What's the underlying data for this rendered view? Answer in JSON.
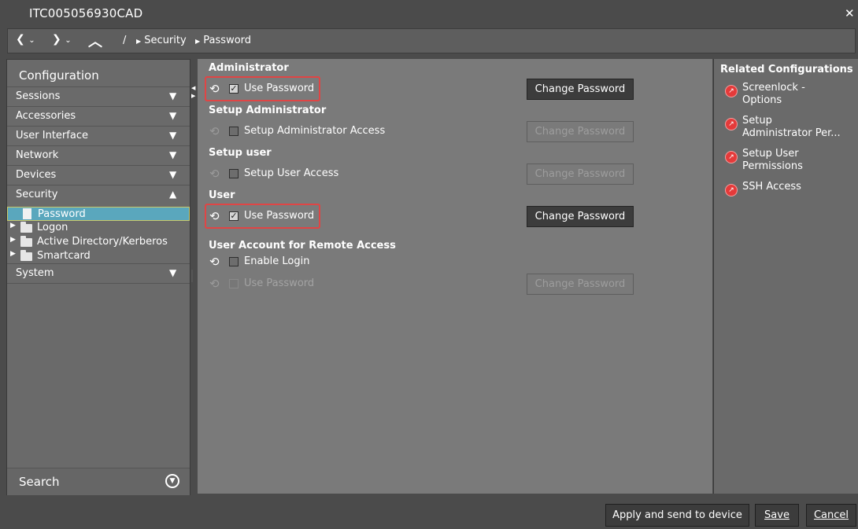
{
  "window": {
    "title": "ITC005056930CAD",
    "close_glyph": "✕"
  },
  "nav": {
    "back_glyph": "❮",
    "forward_glyph": "❯",
    "up_glyph": "︿",
    "dropdown_glyph": "⌄",
    "root_sep": "/",
    "breadcrumbs": [
      "Security",
      "Password"
    ],
    "crumb_glyph": "▶"
  },
  "sidebar": {
    "title": "Configuration",
    "collapsed_glyph": "▼",
    "expanded_glyph": "▲",
    "sections": [
      {
        "label": "Sessions"
      },
      {
        "label": "Accessories"
      },
      {
        "label": "User Interface"
      },
      {
        "label": "Network"
      },
      {
        "label": "Devices"
      },
      {
        "label": "Security"
      }
    ],
    "security_children": [
      "Password",
      "Logon",
      "Active Directory/Kerberos",
      "Smartcard"
    ],
    "tree_expand_glyph": "▶",
    "after_section": {
      "label": "System"
    },
    "search_label": "Search",
    "search_glyph": "▼"
  },
  "main": {
    "reset_glyph": "⟲",
    "check_glyph": "✓",
    "groups": [
      {
        "title": "Administrator",
        "row_label": "Use Password",
        "checked": true,
        "enabled": true,
        "button": "Change Password",
        "button_enabled": true
      },
      {
        "title": "Setup Administrator",
        "row_label": "Setup Administrator Access",
        "checked": false,
        "enabled": false,
        "button": "Change Password",
        "button_enabled": false
      },
      {
        "title": "Setup user",
        "row_label": "Setup User Access",
        "checked": false,
        "enabled": false,
        "button": "Change Password",
        "button_enabled": false
      },
      {
        "title": "User",
        "row_label": "Use Password",
        "checked": true,
        "enabled": true,
        "button": "Change Password",
        "button_enabled": true
      },
      {
        "title": "User Account for Remote Access",
        "row_label": "Enable Login",
        "checked": false,
        "enabled": true
      },
      {
        "row_label": "Use Password",
        "checked": false,
        "enabled": false,
        "button": "Change Password",
        "button_enabled": false
      }
    ]
  },
  "related": {
    "title": "Related Configurations",
    "link_glyph": "↗",
    "links": [
      {
        "line1": "Screenlock -",
        "line2": "Options"
      },
      {
        "line1": "Setup",
        "line2": "Administrator Per..."
      },
      {
        "line1": "Setup User",
        "line2": "Permissions"
      },
      {
        "line1": "SSH Access",
        "line2": ""
      }
    ]
  },
  "footer": {
    "apply_label": "Apply and send to device",
    "save_label": "Save",
    "cancel_label": "Cancel"
  },
  "colors": {
    "accent_selected": "#5aa7bd",
    "highlight_border": "#e04545",
    "link_icon": "#e53a3a"
  }
}
